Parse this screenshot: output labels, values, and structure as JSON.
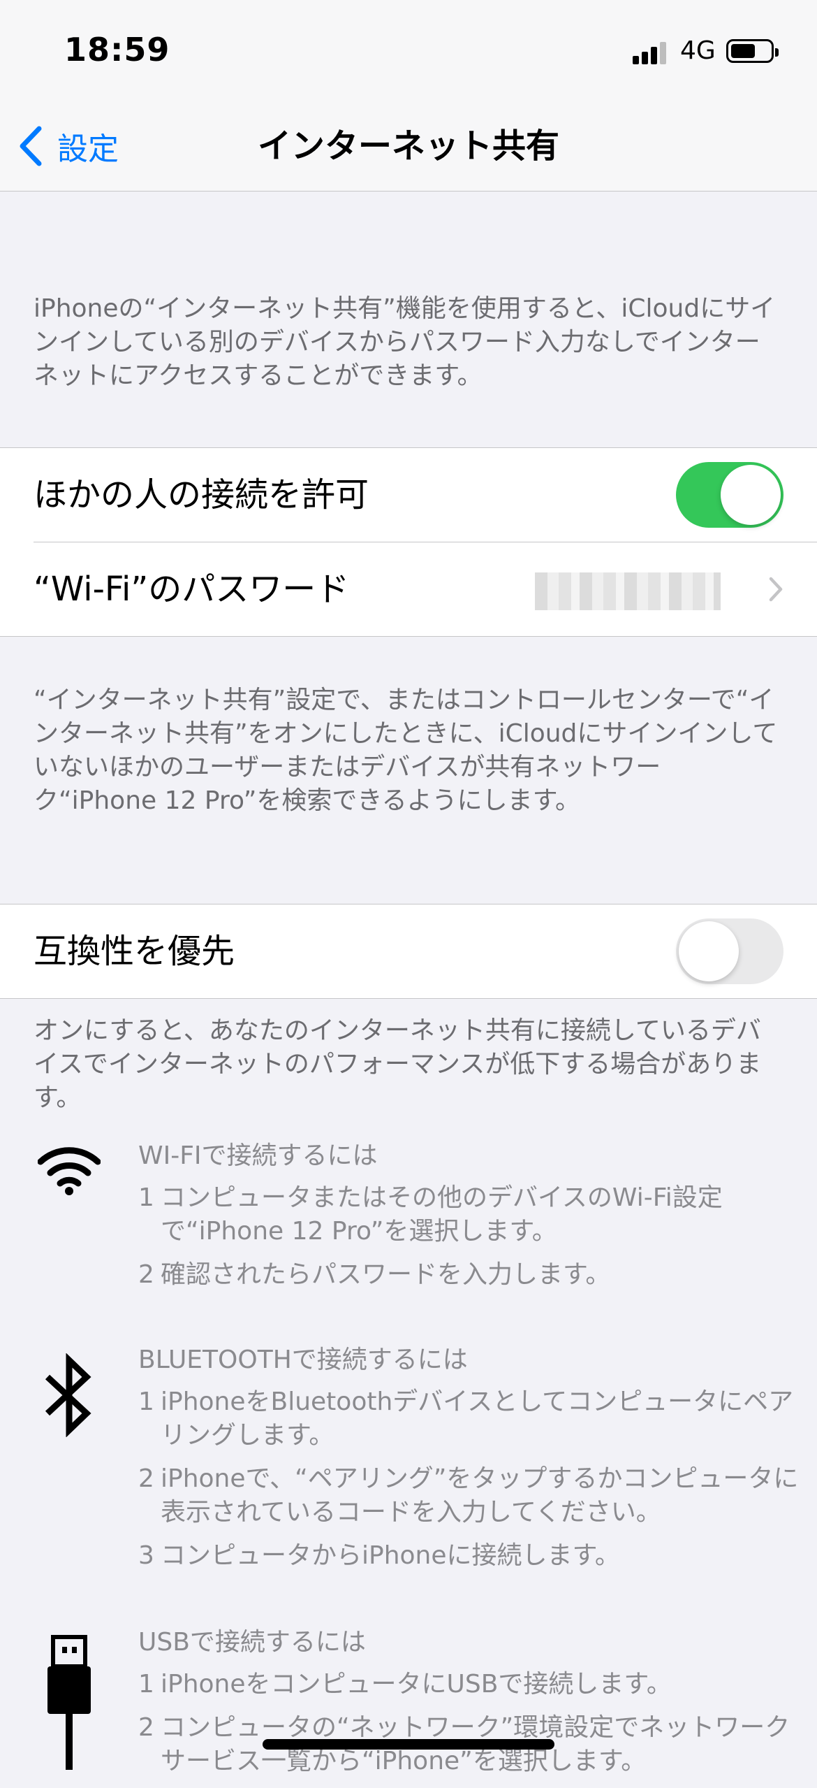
{
  "status_bar": {
    "time": "18:59",
    "network": "4G",
    "icons": [
      "signal-icon",
      "battery-icon"
    ]
  },
  "nav": {
    "back_label": "設定",
    "title": "インターネット共有"
  },
  "intro_text": "iPhoneの“インターネット共有”機能を使用すると、iCloudにサインインしている別のデバイスからパスワード入力なしでインターネットにアクセスすることができます。",
  "group1": {
    "allow_others": {
      "label": "ほかの人の接続を許可",
      "on": true
    },
    "wifi_password": {
      "label": "“Wi-Fi”のパスワード"
    }
  },
  "group1_footer": "“インターネット共有”設定で、またはコントロールセンターで“インターネット共有”をオンにしたときに、iCloudにサインインしていないほかのユーザーまたはデバイスが共有ネットワーク“iPhone 12 Pro”を検索できるようにします。",
  "group2": {
    "compat": {
      "label": "互換性を優先",
      "on": false
    }
  },
  "group2_footer": "オンにすると、あなたのインターネット共有に接続しているデバイスでインターネットのパフォーマンスが低下する場合があります。",
  "instructions": [
    {
      "icon": "wifi-icon",
      "heading": "WI-FIで接続するには",
      "steps": [
        {
          "num": "1",
          "text": "コンピュータまたはその他のデバイスのWi-Fi設定で“iPhone 12 Pro”を選択します。"
        },
        {
          "num": "2",
          "text": "確認されたらパスワードを入力します。"
        }
      ]
    },
    {
      "icon": "bluetooth-icon",
      "heading": "BLUETOOTHで接続するには",
      "steps": [
        {
          "num": "1",
          "text": "iPhoneをBluetoothデバイスとしてコンピュータにペアリングします。"
        },
        {
          "num": "2",
          "text": "iPhoneで、“ペアリング”をタップするかコンピュータに表示されているコードを入力してください。"
        },
        {
          "num": "3",
          "text": "コンピュータからiPhoneに接続します。"
        }
      ]
    },
    {
      "icon": "usb-icon",
      "heading": "USBで接続するには",
      "steps": [
        {
          "num": "1",
          "text": "iPhoneをコンピュータにUSBで接続します。"
        },
        {
          "num": "2",
          "text": "コンピュータの“ネットワーク”環境設定でネットワークサービス一覧から“iPhone”を選択します。"
        }
      ]
    }
  ],
  "colors": {
    "accent": "#007aff",
    "toggle_on": "#34c759",
    "background": "#f2f2f7"
  }
}
